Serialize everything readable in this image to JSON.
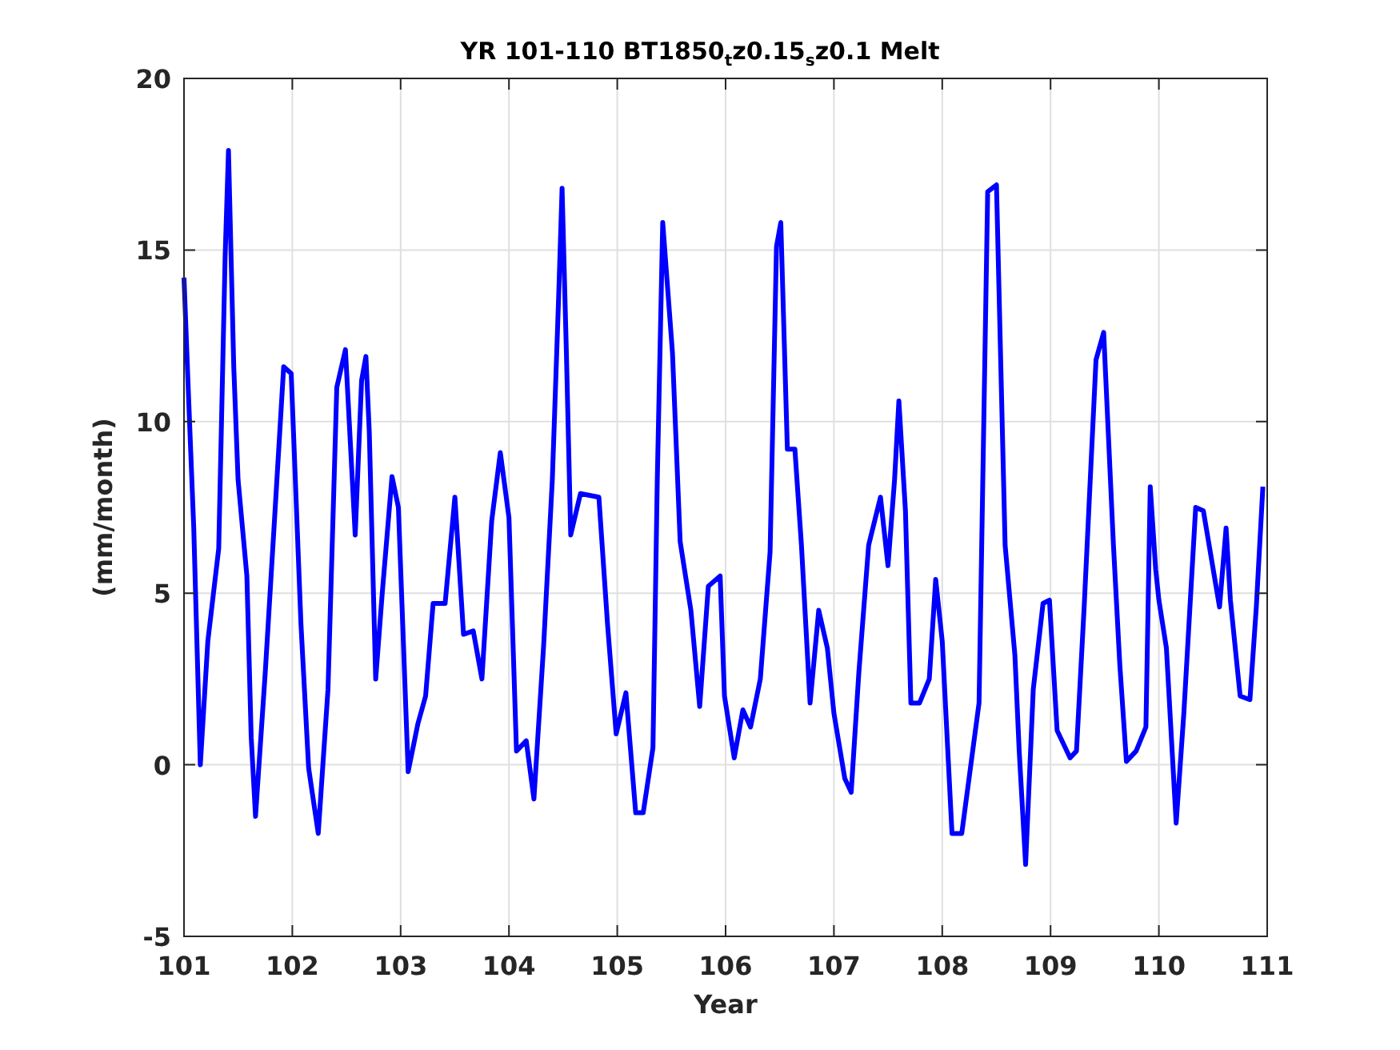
{
  "figure": {
    "chart_data": {
      "type": "line",
      "title": "YR 101-110 BT1850$_{t}$z0.15$_{s}$z0.1 Melt",
      "xlabel": "Year",
      "ylabel": "(mm/month)",
      "x": [
        101.0,
        101.04,
        101.09,
        101.15,
        101.22,
        101.32,
        101.38,
        101.41,
        101.46,
        101.5,
        101.58,
        101.62,
        101.66,
        101.75,
        101.84,
        101.92,
        101.99,
        102.08,
        102.15,
        102.24,
        102.33,
        102.41,
        102.49,
        102.58,
        102.64,
        102.68,
        102.71,
        102.77,
        102.83,
        102.92,
        102.98,
        103.07,
        103.16,
        103.23,
        103.3,
        103.41,
        103.5,
        103.58,
        103.67,
        103.75,
        103.84,
        103.92,
        104.0,
        104.07,
        104.16,
        104.23,
        104.32,
        104.4,
        104.46,
        104.49,
        104.53,
        104.57,
        104.66,
        104.83,
        104.91,
        104.99,
        105.08,
        105.17,
        105.24,
        105.33,
        105.37,
        105.42,
        105.51,
        105.58,
        105.68,
        105.76,
        105.84,
        105.95,
        105.99,
        106.08,
        106.16,
        106.23,
        106.32,
        106.41,
        106.47,
        106.51,
        106.57,
        106.64,
        106.7,
        106.78,
        106.86,
        106.94,
        107.0,
        107.1,
        107.16,
        107.23,
        107.32,
        107.43,
        107.5,
        107.56,
        107.6,
        107.66,
        107.71,
        107.79,
        107.88,
        107.94,
        108.0,
        108.09,
        108.18,
        108.34,
        108.42,
        108.5,
        108.58,
        108.67,
        108.71,
        108.77,
        108.84,
        108.93,
        108.99,
        109.06,
        109.18,
        109.24,
        109.31,
        109.42,
        109.49,
        109.58,
        109.64,
        109.7,
        109.79,
        109.88,
        109.92,
        109.97,
        110.0,
        110.07,
        110.16,
        110.23,
        110.34,
        110.41,
        110.56,
        110.62,
        110.66,
        110.75,
        110.84,
        110.9,
        110.96
      ],
      "series": [
        {
          "color": "#0000ff",
          "values": [
            14.2,
            10.9,
            6.9,
            0.0,
            3.6,
            6.3,
            14.8,
            17.9,
            11.6,
            8.3,
            5.5,
            0.8,
            -1.5,
            2.7,
            7.4,
            11.6,
            11.4,
            4.1,
            -0.1,
            -2.0,
            2.2,
            11.0,
            12.1,
            6.7,
            11.2,
            11.9,
            9.7,
            2.5,
            5.0,
            8.4,
            7.5,
            -0.2,
            1.2,
            2.0,
            4.7,
            4.7,
            7.8,
            3.8,
            3.9,
            2.5,
            7.1,
            9.1,
            7.2,
            0.4,
            0.7,
            -1.0,
            3.5,
            8.3,
            13.7,
            16.8,
            12.0,
            6.7,
            7.9,
            7.8,
            4.1,
            0.9,
            2.1,
            -1.4,
            -1.4,
            0.5,
            8.3,
            15.8,
            12.0,
            6.5,
            4.5,
            1.7,
            5.2,
            5.5,
            2.0,
            0.2,
            1.6,
            1.1,
            2.5,
            6.2,
            15.1,
            15.8,
            9.2,
            9.2,
            6.4,
            1.8,
            4.5,
            3.4,
            1.5,
            -0.4,
            -0.8,
            2.7,
            6.4,
            7.8,
            5.8,
            8.3,
            10.6,
            7.4,
            1.8,
            1.8,
            2.5,
            5.4,
            3.6,
            -2.0,
            -2.0,
            1.8,
            16.7,
            16.9,
            6.4,
            3.2,
            0.4,
            -2.9,
            2.2,
            4.7,
            4.8,
            1.0,
            0.2,
            0.4,
            4.6,
            11.8,
            12.6,
            6.4,
            2.9,
            0.1,
            0.4,
            1.1,
            8.1,
            5.7,
            4.8,
            3.4,
            -1.7,
            1.5,
            7.5,
            7.4,
            4.6,
            6.9,
            4.8,
            2.0,
            1.9,
            4.6,
            8.1
          ]
        }
      ],
      "xlim": [
        101,
        111
      ],
      "ylim": [
        -5,
        20
      ],
      "xticks": [
        101,
        102,
        103,
        104,
        105,
        106,
        107,
        108,
        109,
        110,
        111
      ],
      "yticks": [
        -5,
        0,
        5,
        10,
        15,
        20
      ],
      "grid": true
    }
  }
}
